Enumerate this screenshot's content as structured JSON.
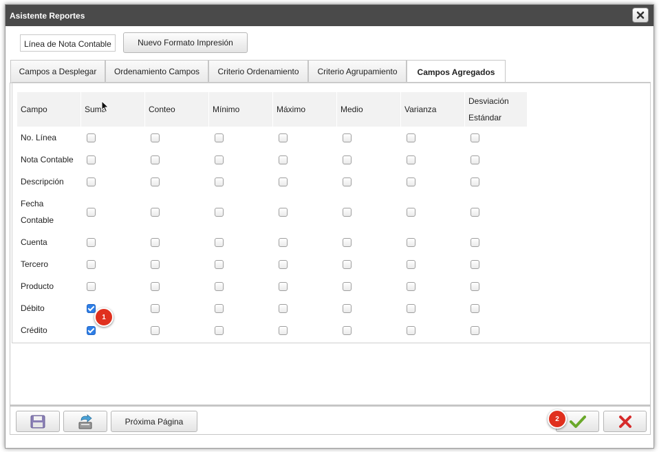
{
  "window": {
    "title": "Asistente Reportes"
  },
  "header": {
    "field_value": "Línea de Nota Contable",
    "new_format_label": "Nuevo Formato Impresión"
  },
  "tabs": [
    {
      "label": "Campos a Desplegar"
    },
    {
      "label": "Ordenamiento Campos"
    },
    {
      "label": "Criterio Ordenamiento"
    },
    {
      "label": "Criterio Agrupamiento"
    },
    {
      "label": "Campos Agregados",
      "active": true
    }
  ],
  "table": {
    "columns": [
      "Campo",
      "Suma",
      "Conteo",
      "Mínimo",
      "Máximo",
      "Medio",
      "Varianza",
      "Desviación Estándar"
    ],
    "rows": [
      {
        "campo": "No. Línea",
        "checks": [
          false,
          false,
          false,
          false,
          false,
          false,
          false
        ]
      },
      {
        "campo": "Nota Contable",
        "checks": [
          false,
          false,
          false,
          false,
          false,
          false,
          false
        ]
      },
      {
        "campo": "Descripción",
        "checks": [
          false,
          false,
          false,
          false,
          false,
          false,
          false
        ]
      },
      {
        "campo": "Fecha Contable",
        "checks": [
          false,
          false,
          false,
          false,
          false,
          false,
          false
        ]
      },
      {
        "campo": "Cuenta",
        "checks": [
          false,
          false,
          false,
          false,
          false,
          false,
          false
        ]
      },
      {
        "campo": "Tercero",
        "checks": [
          false,
          false,
          false,
          false,
          false,
          false,
          false
        ]
      },
      {
        "campo": "Producto",
        "checks": [
          false,
          false,
          false,
          false,
          false,
          false,
          false
        ]
      },
      {
        "campo": "Débito",
        "checks": [
          true,
          false,
          false,
          false,
          false,
          false,
          false
        ]
      },
      {
        "campo": "Crédito",
        "checks": [
          true,
          false,
          false,
          false,
          false,
          false,
          false
        ]
      }
    ]
  },
  "footer": {
    "next_page_label": "Próxima Página"
  },
  "badges": {
    "one": "1",
    "two": "2"
  },
  "icons": {
    "close": "close-icon",
    "save": "save-disk-icon",
    "export": "export-tray-icon",
    "accept": "check-icon",
    "cancel": "cancel-x-icon",
    "cursor": "mouse-pointer-icon"
  },
  "colors": {
    "titlebar": "#4a4a4a",
    "check_blue": "#2f7fe6",
    "accept_green": "#6aa82a",
    "cancel_red": "#d62b2b",
    "badge_red": "#e0301e"
  }
}
